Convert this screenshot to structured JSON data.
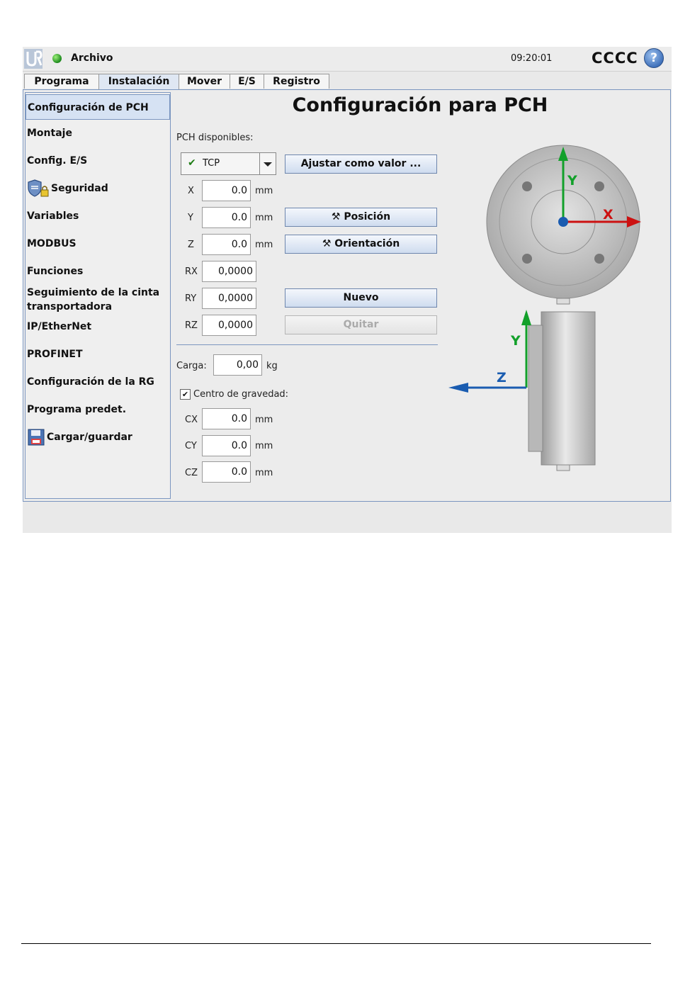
{
  "titlebar": {
    "menu": "Archivo",
    "time": "09:20:01",
    "robot_name": "CCCC",
    "help": "?"
  },
  "tabs": [
    "Programa",
    "Instalación",
    "Mover",
    "E/S",
    "Registro"
  ],
  "active_tab": "Instalación",
  "sidebar": {
    "items": [
      "Configuración de PCH",
      "Montaje",
      "Config. E/S",
      "Seguridad",
      "Variables",
      "MODBUS",
      "Funciones",
      "Seguimiento de la cinta transportadora",
      "IP/EtherNet",
      "PROFINET",
      "Configuración de la RG",
      "Programa predet.",
      "Cargar/guardar"
    ]
  },
  "main": {
    "title": "Configuración para PCH",
    "available_label": "PCH disponibles:",
    "tcp_selected": "TCP",
    "fields": {
      "x": {
        "label": "X",
        "value": "0.0",
        "unit": "mm"
      },
      "y": {
        "label": "Y",
        "value": "0.0",
        "unit": "mm"
      },
      "z": {
        "label": "Z",
        "value": "0.0",
        "unit": "mm"
      },
      "rx": {
        "label": "RX",
        "value": "0,0000"
      },
      "ry": {
        "label": "RY",
        "value": "0,0000"
      },
      "rz": {
        "label": "RZ",
        "value": "0,0000"
      }
    },
    "buttons": {
      "set_default": "Ajustar como valor ...",
      "position": "Posición",
      "orientation": "Orientación",
      "new": "Nuevo",
      "remove": "Quitar"
    },
    "payload": {
      "label": "Carga:",
      "value": "0,00",
      "unit": "kg"
    },
    "cog": {
      "label": "Centro de gravedad:",
      "checked": true,
      "cx": {
        "label": "CX",
        "value": "0.0",
        "unit": "mm"
      },
      "cy": {
        "label": "CY",
        "value": "0.0",
        "unit": "mm"
      },
      "cz": {
        "label": "CZ",
        "value": "0.0",
        "unit": "mm"
      }
    },
    "diagram": {
      "axis_x": "X",
      "axis_y": "Y",
      "axis_y2": "Y",
      "axis_z": "Z",
      "colors": {
        "x": "#cc1111",
        "y": "#12a02a",
        "z": "#1a5cb0"
      }
    }
  }
}
